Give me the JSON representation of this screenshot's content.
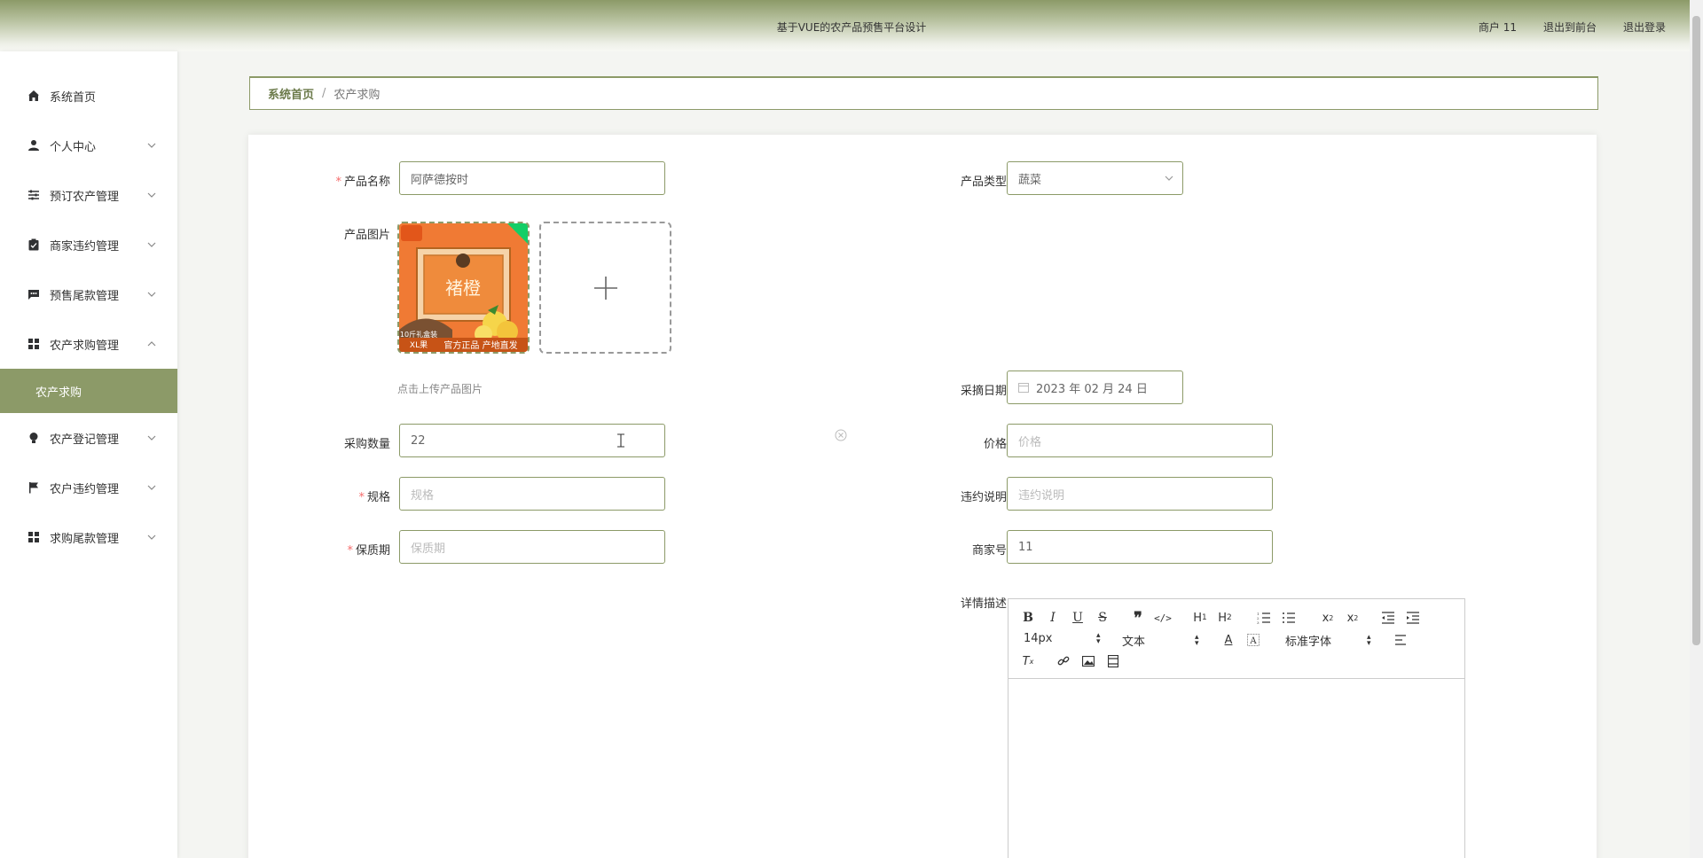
{
  "header": {
    "title": "基于VUE的农产品预售平台设计",
    "user": "商户 11",
    "back_front": "退出到前台",
    "logout": "退出登录"
  },
  "sidebar": {
    "items": [
      {
        "label": "系统首页",
        "icon": "home-icon"
      },
      {
        "label": "个人中心",
        "icon": "user-icon"
      },
      {
        "label": "预订农产管理",
        "icon": "sliders-icon"
      },
      {
        "label": "商家违约管理",
        "icon": "clipboard-check-icon"
      },
      {
        "label": "预售尾款管理",
        "icon": "message-icon"
      },
      {
        "label": "农产求购管理",
        "icon": "grid-icon"
      },
      {
        "label": "农产求购",
        "icon": ""
      },
      {
        "label": "农产登记管理",
        "icon": "bulb-icon"
      },
      {
        "label": "农户违约管理",
        "icon": "flag-icon"
      },
      {
        "label": "求购尾款管理",
        "icon": "grid-icon"
      }
    ]
  },
  "breadcrumb": {
    "home": "系统首页",
    "separator": "/",
    "current": "农产求购"
  },
  "form": {
    "product_name": {
      "label": "产品名称",
      "value": "阿萨德按时"
    },
    "product_type": {
      "label": "产品类型",
      "value": "蔬菜"
    },
    "product_image": {
      "label": "产品图片",
      "hint": "点击上传产品图片",
      "upload_symbol": "+"
    },
    "pick_date": {
      "label": "采摘日期",
      "value": "2023 年 02 月 24 日"
    },
    "quantity": {
      "label": "采购数量",
      "value": "22"
    },
    "price": {
      "label": "价格",
      "placeholder": "价格"
    },
    "spec": {
      "label": "规格",
      "placeholder": "规格"
    },
    "breach_note": {
      "label": "违约说明",
      "placeholder": "违约说明"
    },
    "shelf_life": {
      "label": "保质期",
      "placeholder": "保质期"
    },
    "merchant_no": {
      "label": "商家号",
      "value": "11"
    },
    "detail": {
      "label": "详情描述"
    }
  },
  "editor": {
    "size_picker": "14px",
    "header_picker": "文本",
    "font_picker": "标准字体"
  },
  "product_image": {
    "title_text": "褚橙",
    "badge_text": "10斤礼盒装",
    "size_text": "XL果",
    "banner_text": "官方正品 产地直发"
  }
}
